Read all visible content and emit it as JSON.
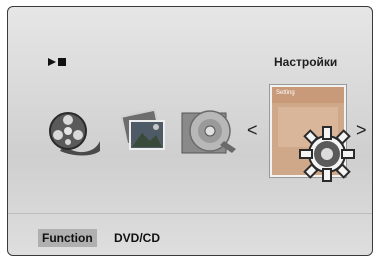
{
  "header": {
    "title": "Настройки"
  },
  "menu": {
    "items": [
      {
        "icon": "film-reel-icon"
      },
      {
        "icon": "photo-icon"
      },
      {
        "icon": "disc-icon"
      },
      {
        "icon": "settings-gear-icon",
        "selected": true,
        "card_label": "Setting"
      }
    ],
    "nav_left": "<",
    "nav_right": ">"
  },
  "footer": {
    "function_label": "Function",
    "function_value": "DVD/CD"
  }
}
